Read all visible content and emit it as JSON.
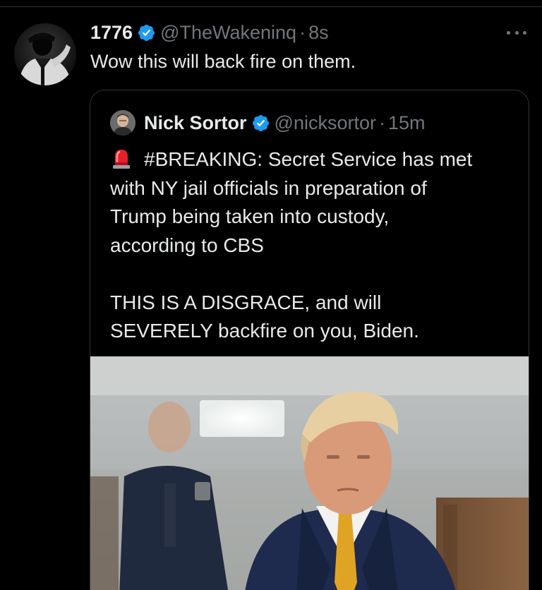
{
  "tweet": {
    "author_name": "1776",
    "handle": "@TheWakeninq",
    "separator": "·",
    "time": "8s",
    "text": "Wow this will back fire on them.",
    "avatar_icon": "silhouette-avatar-icon",
    "more_icon": "more-options-icon"
  },
  "quote": {
    "author_name": "Nick Sortor",
    "handle": "@nicksortor",
    "separator": "·",
    "time": "15m",
    "emoji_icon": "police-siren-icon",
    "lines": [
      "#BREAKING: Secret Service has met",
      "with NY jail officials in preparation of",
      "Trump being taken into custody,",
      "according to CBS",
      "THIS IS A DISGRACE, and will",
      "SEVERELY backfire on you, Biden."
    ]
  },
  "colors": {
    "background": "#000000",
    "text": "#e7e9ea",
    "secondary_text": "#71767b",
    "verified_blue": "#1d9bf0",
    "border": "#333639"
  }
}
